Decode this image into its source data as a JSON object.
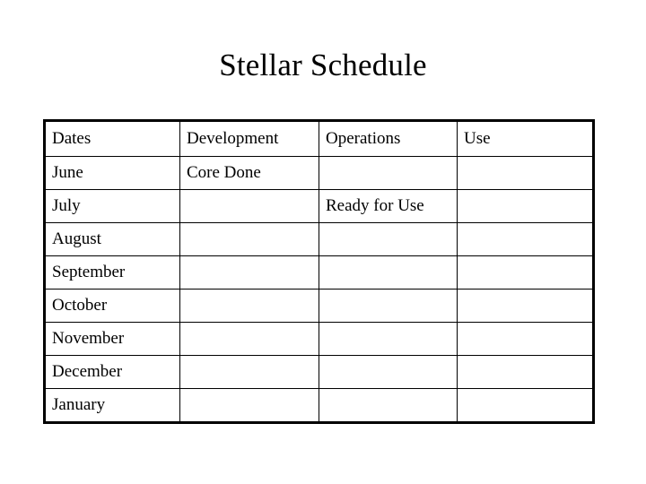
{
  "slide": {
    "title": "Stellar Schedule",
    "background_color": "#ffffff",
    "text_color": "#000000",
    "border_color": "#000000"
  },
  "table": {
    "columns": [
      {
        "key": "dates",
        "header": "Dates"
      },
      {
        "key": "development",
        "header": "Development"
      },
      {
        "key": "operations",
        "header": "Operations"
      },
      {
        "key": "use",
        "header": "Use"
      }
    ],
    "rows": [
      {
        "dates": "June",
        "development": "Core Done",
        "operations": "",
        "use": ""
      },
      {
        "dates": "July",
        "development": "",
        "operations": "Ready for Use",
        "use": ""
      },
      {
        "dates": "August",
        "development": "",
        "operations": "",
        "use": ""
      },
      {
        "dates": "September",
        "development": "",
        "operations": "",
        "use": ""
      },
      {
        "dates": "October",
        "development": "",
        "operations": "",
        "use": ""
      },
      {
        "dates": "November",
        "development": "",
        "operations": "",
        "use": ""
      },
      {
        "dates": "December",
        "development": "",
        "operations": "",
        "use": ""
      },
      {
        "dates": "January",
        "development": "",
        "operations": "",
        "use": ""
      }
    ]
  }
}
